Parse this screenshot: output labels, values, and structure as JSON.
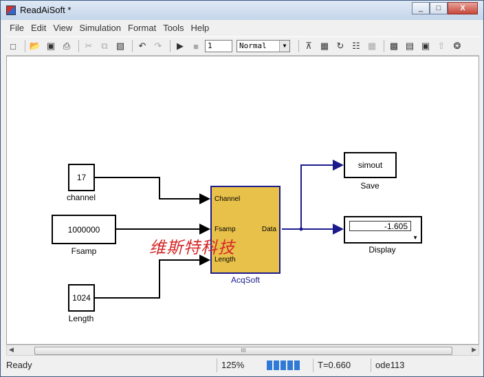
{
  "window": {
    "title": "ReadAiSoft *",
    "controls": [
      "_",
      "□",
      "X"
    ]
  },
  "menu": [
    "File",
    "Edit",
    "View",
    "Simulation",
    "Format",
    "Tools",
    "Help"
  ],
  "toolbar": {
    "stop_time": "1",
    "sim_mode": "Normal"
  },
  "blocks": {
    "channel": {
      "value": "17",
      "label": "channel"
    },
    "fsamp": {
      "value": "1000000",
      "label": "Fsamp"
    },
    "length": {
      "value": "1024",
      "label": "Length"
    },
    "acq": {
      "label": "AcqSoft",
      "ports_in": [
        "Channel",
        "Fsamp",
        "Length"
      ],
      "port_out": "Data"
    },
    "save": {
      "value": "simout",
      "label": "Save"
    },
    "display": {
      "value": "-1.605",
      "label": "Display"
    }
  },
  "watermark": "维斯特科技",
  "scrollbar_grip": "III",
  "status": {
    "state": "Ready",
    "zoom": "125%",
    "time": "T=0.660",
    "solver": "ode113"
  },
  "colors": {
    "block_fill": "#e8c14a",
    "signal_line": "#1a1a8c",
    "watermark": "#d42a2a"
  }
}
